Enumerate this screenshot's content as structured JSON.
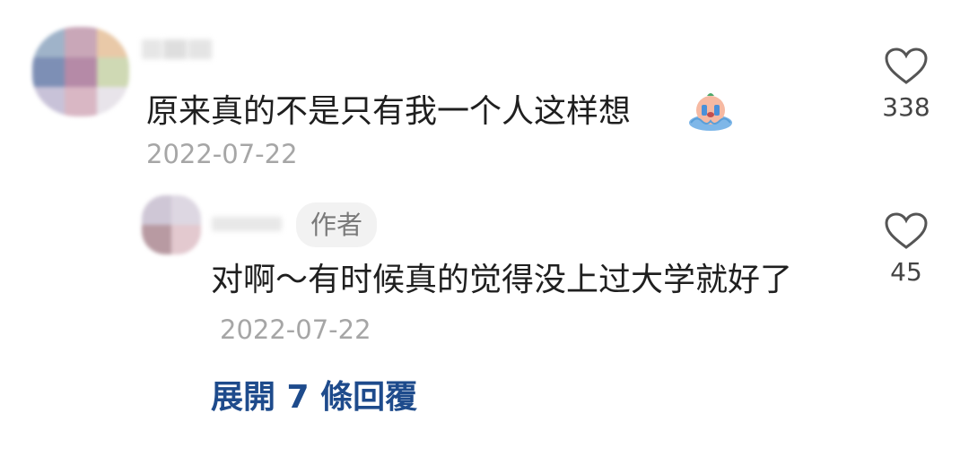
{
  "comment": {
    "text": "原来真的不是只有我一个人这样想",
    "date": "2022-07-22",
    "likes": "338",
    "emoji_icon": "crying-face-icon"
  },
  "reply": {
    "badge": "作者",
    "text": "对啊～有时候真的觉得没上过大学就好了",
    "date": "2022-07-22",
    "likes": "45"
  },
  "expand": {
    "label": "展開 7 條回覆"
  },
  "colors": {
    "link": "#1e4b8c",
    "date": "#a6a6a6",
    "text": "#1f1f1f"
  }
}
